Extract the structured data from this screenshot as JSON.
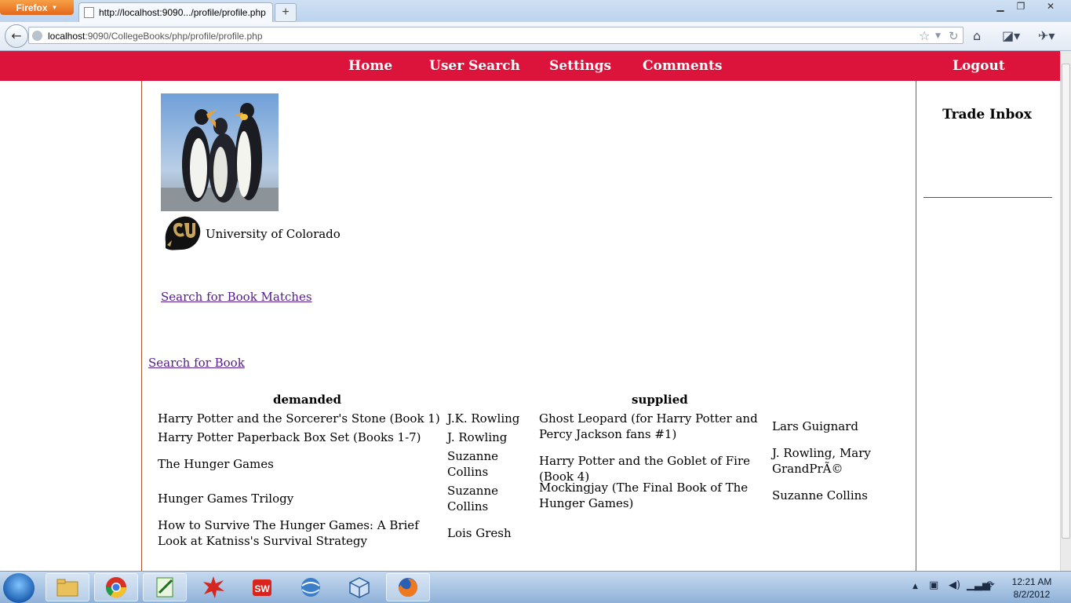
{
  "browser": {
    "app_button": "Firefox",
    "tab_title": "http://localhost:9090.../profile/profile.php",
    "new_tab": "+",
    "url_host": "localhost",
    "url_rest": ":9090/CollegeBooks/php/profile/profile.php"
  },
  "nav": {
    "home": "Home",
    "user_search": "User Search",
    "settings": "Settings",
    "comments": "Comments",
    "logout": "Logout"
  },
  "profile": {
    "university": "University of Colorado",
    "search_matches_link": "Search for Book Matches",
    "search_book_link": "Search for Book"
  },
  "sidebar": {
    "title": "Trade Inbox"
  },
  "demanded": {
    "header": "demanded",
    "rows": [
      {
        "title": "Harry Potter and the Sorcerer's Stone (Book 1)",
        "author": "J.K. Rowling"
      },
      {
        "title": "Harry Potter Paperback Box Set (Books 1-7)",
        "author": "J. Rowling"
      },
      {
        "title": "The Hunger Games",
        "author": "Suzanne Collins"
      },
      {
        "title": "Hunger Games Trilogy",
        "author": "Suzanne Collins"
      },
      {
        "title": "How to Survive The Hunger Games: A Brief Look at Katniss's Survival Strategy",
        "author": "Lois Gresh"
      }
    ]
  },
  "supplied": {
    "header": "supplied",
    "rows": [
      {
        "title": "Ghost Leopard (for Harry Potter and Percy Jackson fans #1)",
        "author": "Lars Guignard"
      },
      {
        "title": "Harry Potter and the Goblet of Fire (Book 4)",
        "author": "J. Rowling, Mary GrandPrÃ©"
      },
      {
        "title": "Mockingjay (The Final Book of The Hunger Games)",
        "author": "Suzanne Collins"
      }
    ]
  },
  "taskbar": {
    "time": "12:21 AM",
    "date": "8/2/2012"
  },
  "colors": {
    "menu_red": "#dc143c",
    "link_purple": "#551a8b"
  }
}
